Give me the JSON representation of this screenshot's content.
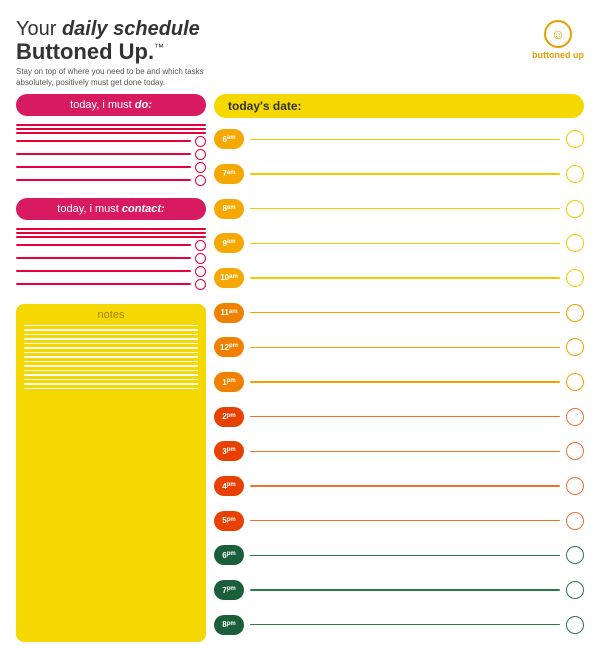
{
  "header": {
    "title_pre": "Your ",
    "title_bold": "daily schedule",
    "brand": "Buttoned Up.",
    "trademark": "™",
    "subtitle": "Stay on top of where you need to be and which tasks absolutely, positively must get done today.",
    "logo_label": "buttoned up"
  },
  "left": {
    "do_label": "today, i must ",
    "do_bold": "do:",
    "contact_label": "today, i must ",
    "contact_bold": "contact:",
    "notes_label": "notes"
  },
  "schedule": {
    "date_label": "today's date:",
    "times": [
      {
        "label": "6",
        "sup": "am",
        "key": "6am"
      },
      {
        "label": "7",
        "sup": "am",
        "key": "7am"
      },
      {
        "label": "8",
        "sup": "am",
        "key": "8am"
      },
      {
        "label": "9",
        "sup": "am",
        "key": "9am"
      },
      {
        "label": "10",
        "sup": "am",
        "key": "10am"
      },
      {
        "label": "11",
        "sup": "am",
        "key": "11am"
      },
      {
        "label": "12",
        "sup": "pm",
        "key": "12pm"
      },
      {
        "label": "1",
        "sup": "pm",
        "key": "1pm"
      },
      {
        "label": "2",
        "sup": "pm",
        "key": "2pm"
      },
      {
        "label": "3",
        "sup": "pm",
        "key": "3pm"
      },
      {
        "label": "4",
        "sup": "pm",
        "key": "4pm"
      },
      {
        "label": "5",
        "sup": "pm",
        "key": "5pm"
      },
      {
        "label": "6",
        "sup": "pm",
        "key": "6pm"
      },
      {
        "label": "7",
        "sup": "pm",
        "key": "7pm"
      },
      {
        "label": "8",
        "sup": "pm",
        "key": "8pm"
      }
    ]
  }
}
